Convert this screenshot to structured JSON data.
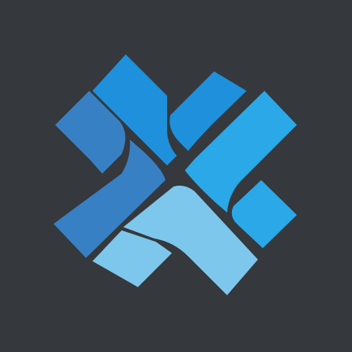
{
  "logo": {
    "icon": "x-shaped-interlocking-ribbon-logo",
    "background_color": "#35383c",
    "colors": {
      "top": "#1e90dc",
      "right": "#2aa8e8",
      "bottom": "#7ec7ec",
      "left": "#3880c4"
    }
  }
}
